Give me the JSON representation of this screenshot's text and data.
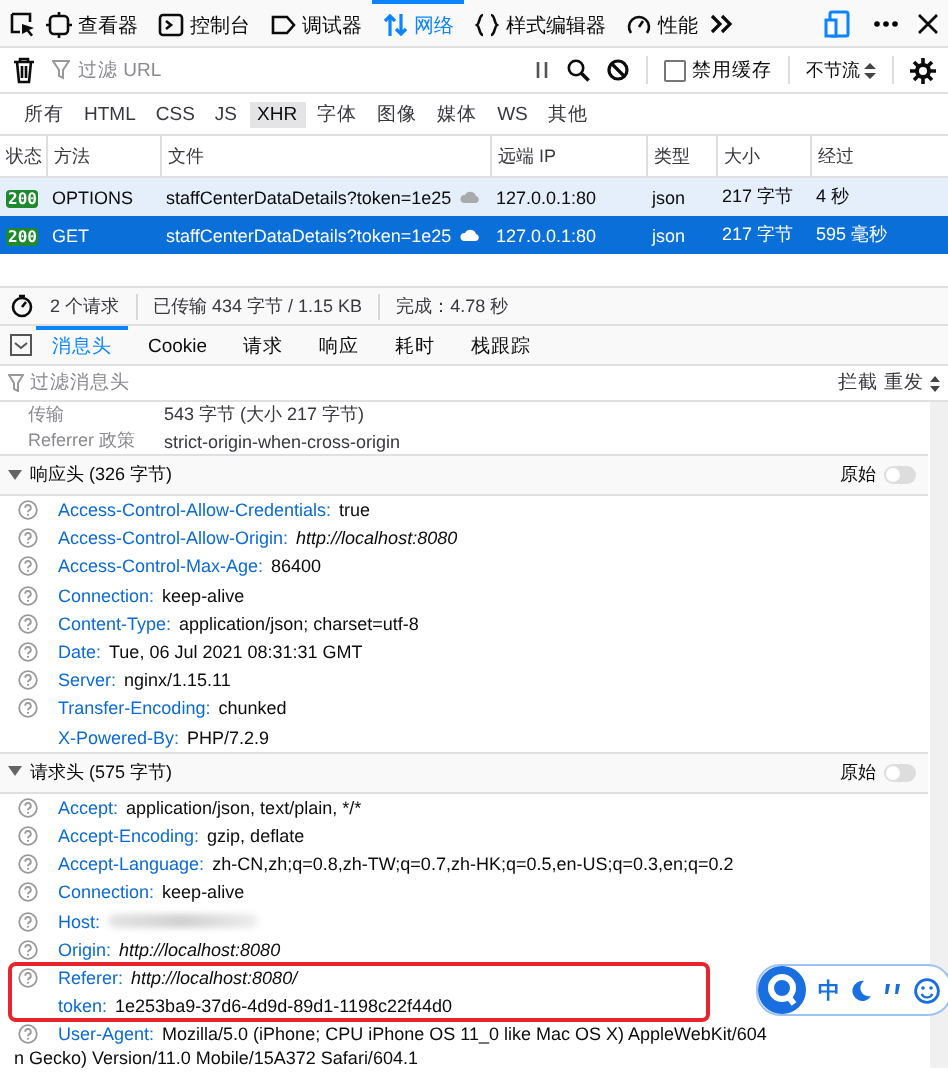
{
  "toolbar": {
    "tools": [
      {
        "label": "查看器",
        "selected": false
      },
      {
        "label": "控制台",
        "selected": false
      },
      {
        "label": "调试器",
        "selected": false
      },
      {
        "label": "网络",
        "selected": true
      },
      {
        "label": "样式编辑器",
        "selected": false
      },
      {
        "label": "性能",
        "selected": false
      }
    ]
  },
  "filter_bar": {
    "placeholder": "过滤 URL",
    "disable_cache": {
      "label": "禁用缓存",
      "checked": false
    },
    "throttle": "不节流"
  },
  "type_filters": [
    {
      "label": "所有",
      "selected": false
    },
    {
      "label": "HTML",
      "selected": false
    },
    {
      "label": "CSS",
      "selected": false
    },
    {
      "label": "JS",
      "selected": false
    },
    {
      "label": "XHR",
      "selected": true
    },
    {
      "label": "字体",
      "selected": false
    },
    {
      "label": "图像",
      "selected": false
    },
    {
      "label": "媒体",
      "selected": false
    },
    {
      "label": "WS",
      "selected": false
    },
    {
      "label": "其他",
      "selected": false
    }
  ],
  "table": {
    "columns": [
      "状态",
      "方法",
      "文件",
      "远端 IP",
      "类型",
      "大小",
      "经过"
    ],
    "rows": [
      {
        "status": "200",
        "method": "OPTIONS",
        "file": "staffCenterDataDetails?token=1e25",
        "ip": "127.0.0.1:80",
        "type": "json",
        "size": "217 字节",
        "time": "4 秒",
        "selected": false
      },
      {
        "status": "200",
        "method": "GET",
        "file": "staffCenterDataDetails?token=1e25",
        "ip": "127.0.0.1:80",
        "type": "json",
        "size": "217 字节",
        "time": "595 毫秒",
        "selected": true
      }
    ]
  },
  "status_bar": [
    "2 个请求",
    "已传输 434 字节 / 1.15 KB",
    "完成：4.78 秒"
  ],
  "detail_tabs": [
    {
      "label": "消息头",
      "selected": true
    },
    {
      "label": "Cookie",
      "selected": false
    },
    {
      "label": "请求",
      "selected": false
    },
    {
      "label": "响应",
      "selected": false
    },
    {
      "label": "耗时",
      "selected": false
    },
    {
      "label": "栈跟踪",
      "selected": false
    }
  ],
  "header_filter": {
    "placeholder": "过滤消息头",
    "actions": [
      "拦截",
      "重发"
    ]
  },
  "summary": [
    {
      "label": "传输",
      "value": "543 字节 (大小 217 字节)"
    },
    {
      "label": "Referrer 政策",
      "value": "strict-origin-when-cross-origin"
    }
  ],
  "sections": [
    {
      "title": "响应头 (326 字节)",
      "raw_label": "原始",
      "raw_on": false,
      "headers": [
        {
          "name": "Access-Control-Allow-Credentials:",
          "value": "true",
          "kind": "text",
          "help": true,
          "highlighted": false
        },
        {
          "name": "Access-Control-Allow-Origin:",
          "value": "http://localhost:8080",
          "kind": "url",
          "help": true,
          "highlighted": false
        },
        {
          "name": "Access-Control-Max-Age:",
          "value": "86400",
          "kind": "text",
          "help": true,
          "highlighted": false
        },
        {
          "name": "Connection:",
          "value": "keep-alive",
          "kind": "text",
          "help": true,
          "highlighted": false
        },
        {
          "name": "Content-Type:",
          "value": "application/json; charset=utf-8",
          "kind": "text",
          "help": true,
          "highlighted": false
        },
        {
          "name": "Date:",
          "value": "Tue, 06 Jul 2021 08:31:31 GMT",
          "kind": "text",
          "help": true,
          "highlighted": false
        },
        {
          "name": "Server:",
          "value": "nginx/1.15.11",
          "kind": "text",
          "help": true,
          "highlighted": false
        },
        {
          "name": "Transfer-Encoding:",
          "value": "chunked",
          "kind": "text",
          "help": true,
          "highlighted": false
        },
        {
          "name": "X-Powered-By:",
          "value": "PHP/7.2.9",
          "kind": "text",
          "help": false,
          "highlighted": false
        }
      ]
    },
    {
      "title": "请求头 (575 字节)",
      "raw_label": "原始",
      "raw_on": false,
      "headers": [
        {
          "name": "Accept:",
          "value": "application/json, text/plain, */*",
          "kind": "text",
          "help": true,
          "highlighted": false
        },
        {
          "name": "Accept-Encoding:",
          "value": "gzip, deflate",
          "kind": "text",
          "help": true,
          "highlighted": false
        },
        {
          "name": "Accept-Language:",
          "value": "zh-CN,zh;q=0.8,zh-TW;q=0.7,zh-HK;q=0.5,en-US;q=0.3,en;q=0.2",
          "kind": "text",
          "help": true,
          "highlighted": false
        },
        {
          "name": "Connection:",
          "value": "keep-alive",
          "kind": "text",
          "help": true,
          "highlighted": false
        },
        {
          "name": "Host:",
          "kind": "redacted",
          "help": true,
          "highlighted": false
        },
        {
          "name": "Origin:",
          "value": "http://localhost:8080",
          "kind": "url",
          "help": true,
          "highlighted": false
        },
        {
          "name": "Referer:",
          "value": "http://localhost:8080/",
          "kind": "url",
          "help": true,
          "highlighted": true
        },
        {
          "name": "token:",
          "value": "1e253ba9-37d6-4d9d-89d1-1198c22f44d0",
          "kind": "text",
          "help": false,
          "highlighted": true
        },
        {
          "name": "User-Agent:",
          "value": "Mozilla/5.0 (iPhone; CPU iPhone OS 11_0 like Mac OS X) AppleWebKit/604",
          "continuation": "n Gecko) Version/11.0 Mobile/15A372 Safari/604.1",
          "kind": "text",
          "help": true,
          "highlighted": false
        }
      ]
    }
  ],
  "ime_bar": {
    "label": "中"
  }
}
